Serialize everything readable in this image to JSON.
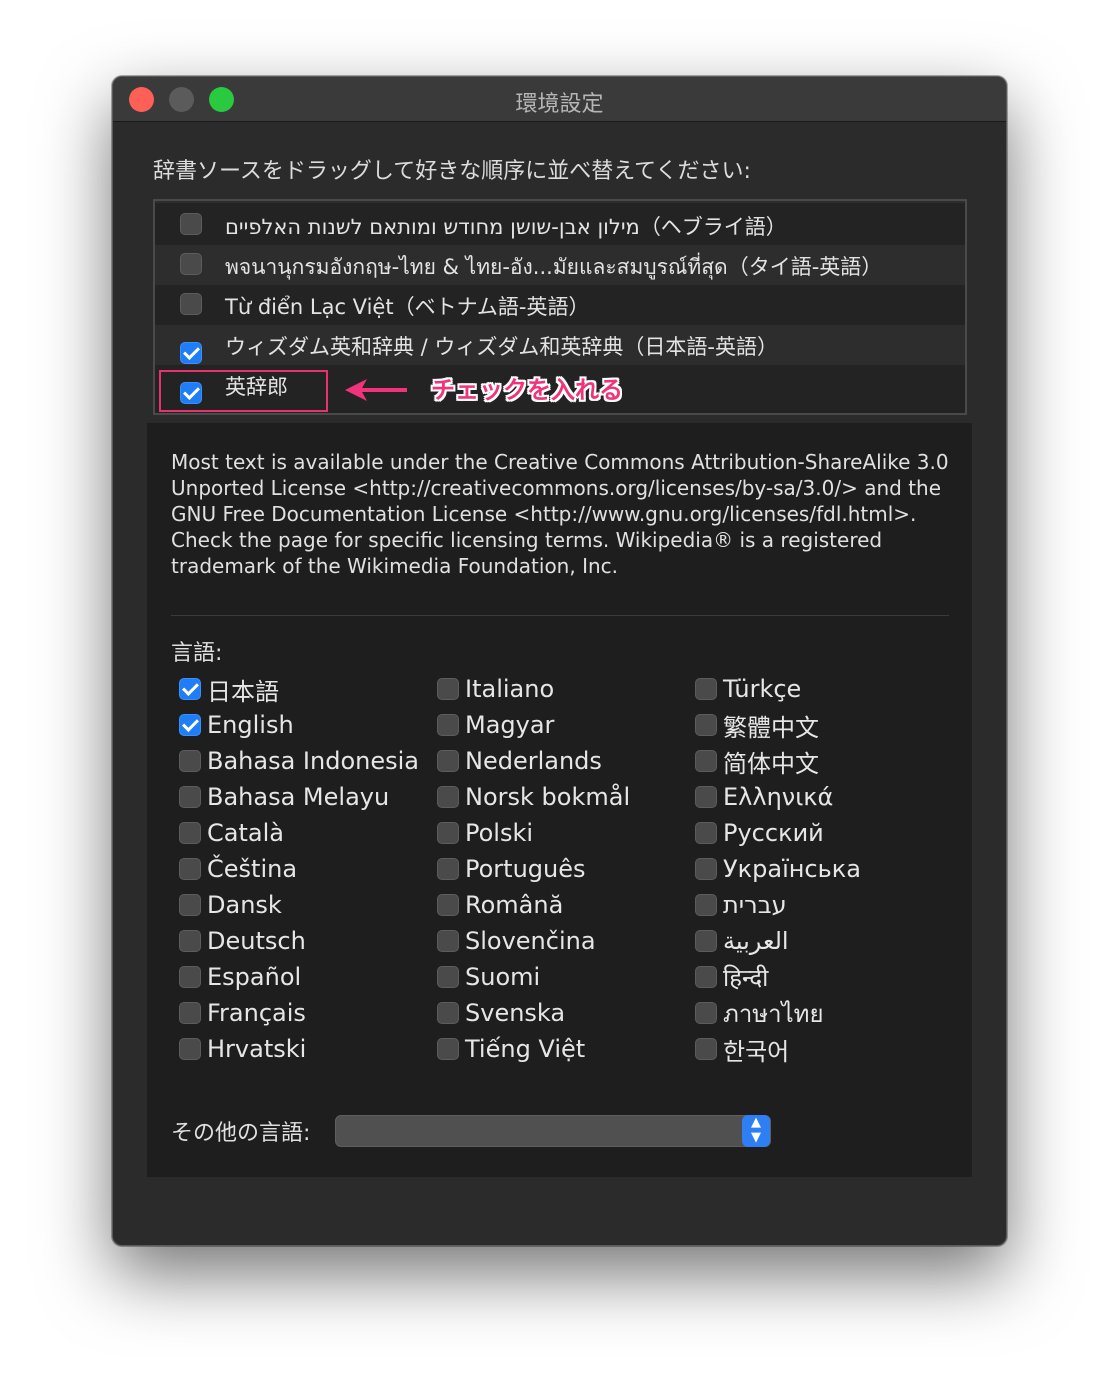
{
  "window": {
    "title": "環境設定"
  },
  "instruction": "辞書ソースをドラッグして好きな順序に並べ替えてください:",
  "dictionaries": [
    {
      "label": "מילון אבן-שושן מחודש ומותאם לשנות האלפיים（ヘブライ語）",
      "checked": false
    },
    {
      "label": "พจนานุกรมอังกฤษ-ไทย & ไทย-อัง...มัยและสมบูรณ์ที่สุด（タイ語-英語）",
      "checked": false
    },
    {
      "label": "Từ điển Lạc Việt（ベトナム語-英語）",
      "checked": false
    },
    {
      "label": "ウィズダム英和辞典 / ウィズダム和英辞典（日本語-英語）",
      "checked": true
    },
    {
      "label": "英辞郎",
      "checked": true
    }
  ],
  "annotation": {
    "text": "チェックを入れる",
    "color": "#f0337a"
  },
  "license_text": "Most text is available under the Creative Commons Attribution-ShareAlike 3.0 Unported License <http://creativecommons.org/licenses/by-sa/3.0/> and the GNU Free Documentation License <http://www.gnu.org/licenses/fdl.html>. Check the page for specific licensing terms. Wikipedia® is a registered trademark of the Wikimedia Foundation, Inc.",
  "languages_title": "言語:",
  "languages": [
    [
      {
        "label": "日本語",
        "checked": true
      },
      {
        "label": "English",
        "checked": true
      },
      {
        "label": "Bahasa Indonesia",
        "checked": false
      },
      {
        "label": "Bahasa Melayu",
        "checked": false
      },
      {
        "label": "Català",
        "checked": false
      },
      {
        "label": "Čeština",
        "checked": false
      },
      {
        "label": "Dansk",
        "checked": false
      },
      {
        "label": "Deutsch",
        "checked": false
      },
      {
        "label": "Español",
        "checked": false
      },
      {
        "label": "Français",
        "checked": false
      },
      {
        "label": "Hrvatski",
        "checked": false
      }
    ],
    [
      {
        "label": "Italiano",
        "checked": false
      },
      {
        "label": "Magyar",
        "checked": false
      },
      {
        "label": "Nederlands",
        "checked": false
      },
      {
        "label": "Norsk bokmål",
        "checked": false
      },
      {
        "label": "Polski",
        "checked": false
      },
      {
        "label": "Português",
        "checked": false
      },
      {
        "label": "Română",
        "checked": false
      },
      {
        "label": "Slovenčina",
        "checked": false
      },
      {
        "label": "Suomi",
        "checked": false
      },
      {
        "label": "Svenska",
        "checked": false
      },
      {
        "label": "Tiếng Việt",
        "checked": false
      }
    ],
    [
      {
        "label": "Türkçe",
        "checked": false
      },
      {
        "label": "繁體中文",
        "checked": false
      },
      {
        "label": "简体中文",
        "checked": false
      },
      {
        "label": "Ελληνικά",
        "checked": false
      },
      {
        "label": "Русский",
        "checked": false
      },
      {
        "label": "Українська",
        "checked": false
      },
      {
        "label": "עברית",
        "checked": false
      },
      {
        "label": "العربية",
        "checked": false
      },
      {
        "label": "हिन्दी",
        "checked": false
      },
      {
        "label": "ภาษาไทย",
        "checked": false
      },
      {
        "label": "한국어",
        "checked": false
      }
    ]
  ],
  "other_languages_label": "その他の言語:",
  "other_languages_value": ""
}
